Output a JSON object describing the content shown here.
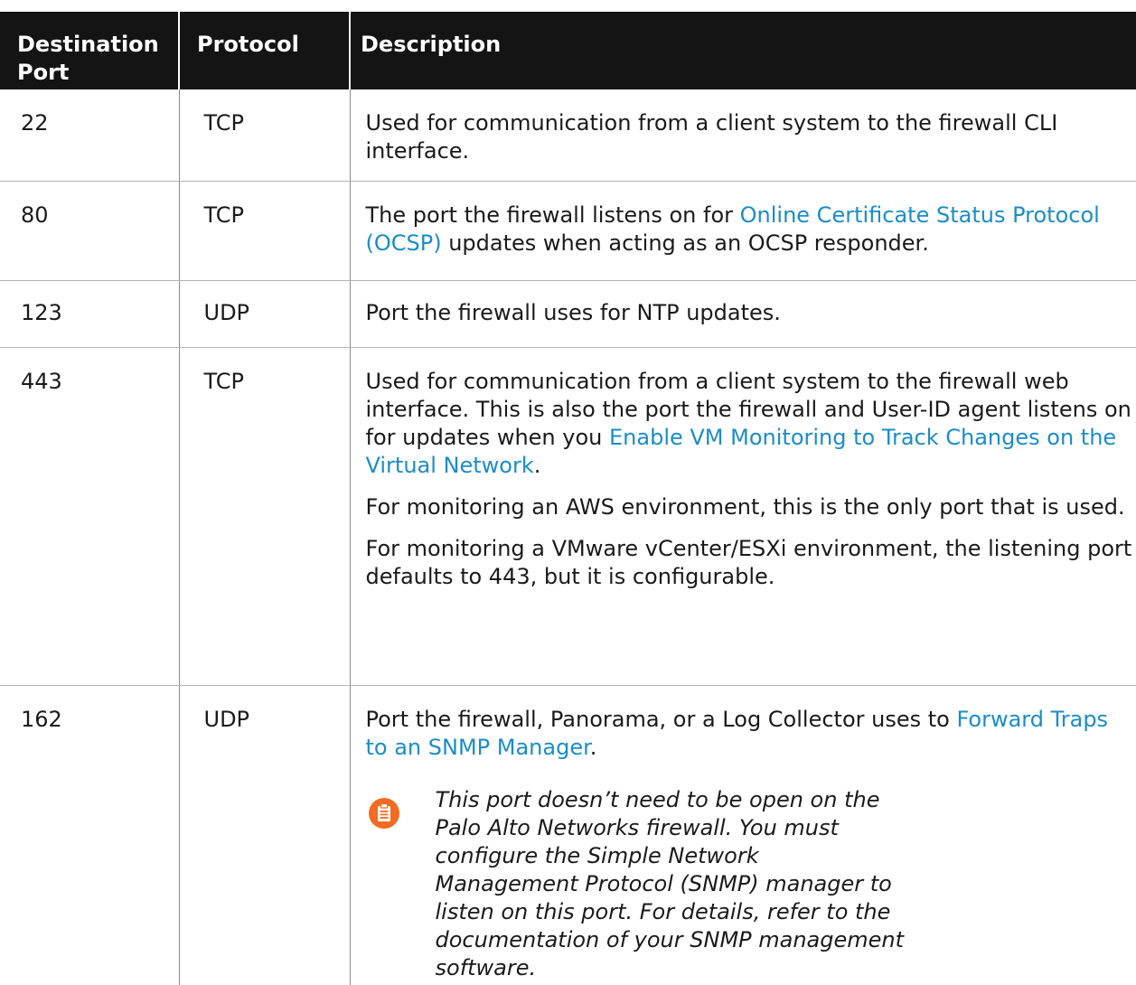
{
  "table": {
    "headers": {
      "port": "Destination Port",
      "protocol": "Protocol",
      "description": "Description"
    },
    "rows": [
      {
        "port": "22",
        "protocol": "TCP",
        "desc_text": "Used for communication from a client system to the firewall CLI interface."
      },
      {
        "port": "80",
        "protocol": "TCP",
        "desc_before": "The port the firewall listens on for ",
        "desc_link": "Online Certificate Status Protocol (OCSP)",
        "desc_after": " updates when acting as an OCSP responder."
      },
      {
        "port": "123",
        "protocol": "UDP",
        "desc_text": "Port the firewall uses for NTP updates."
      },
      {
        "port": "443",
        "protocol": "TCP",
        "desc_before": "Used for communication from a client system to the firewall web interface. This is also the port the firewall and User-ID agent listens on for updates when you ",
        "desc_link": "Enable VM Monitoring to Track Changes on the Virtual Network",
        "desc_after": ".",
        "desc_p2": "For monitoring an AWS environment, this is the only port that is used.",
        "desc_p3": "For monitoring a VMware vCenter/ESXi environment, the listening port defaults to 443, but it is configurable."
      },
      {
        "port": "162",
        "protocol": "UDP",
        "desc_before": "Port the firewall, Panorama, or a Log Collector uses to ",
        "desc_link": "Forward Traps to an SNMP Manager",
        "desc_after": ".",
        "note": "This port doesn’t need to be open on the Palo Alto Networks firewall. You must configure the Simple Network Management Protocol (SNMP) manager to listen on this port. For details, refer to the documentation of your SNMP management software.",
        "note_icon": "clipboard-note-icon"
      }
    ]
  },
  "colors": {
    "header_bg": "#141414",
    "link": "#1a8dc8",
    "note_icon": "#f26b21"
  }
}
